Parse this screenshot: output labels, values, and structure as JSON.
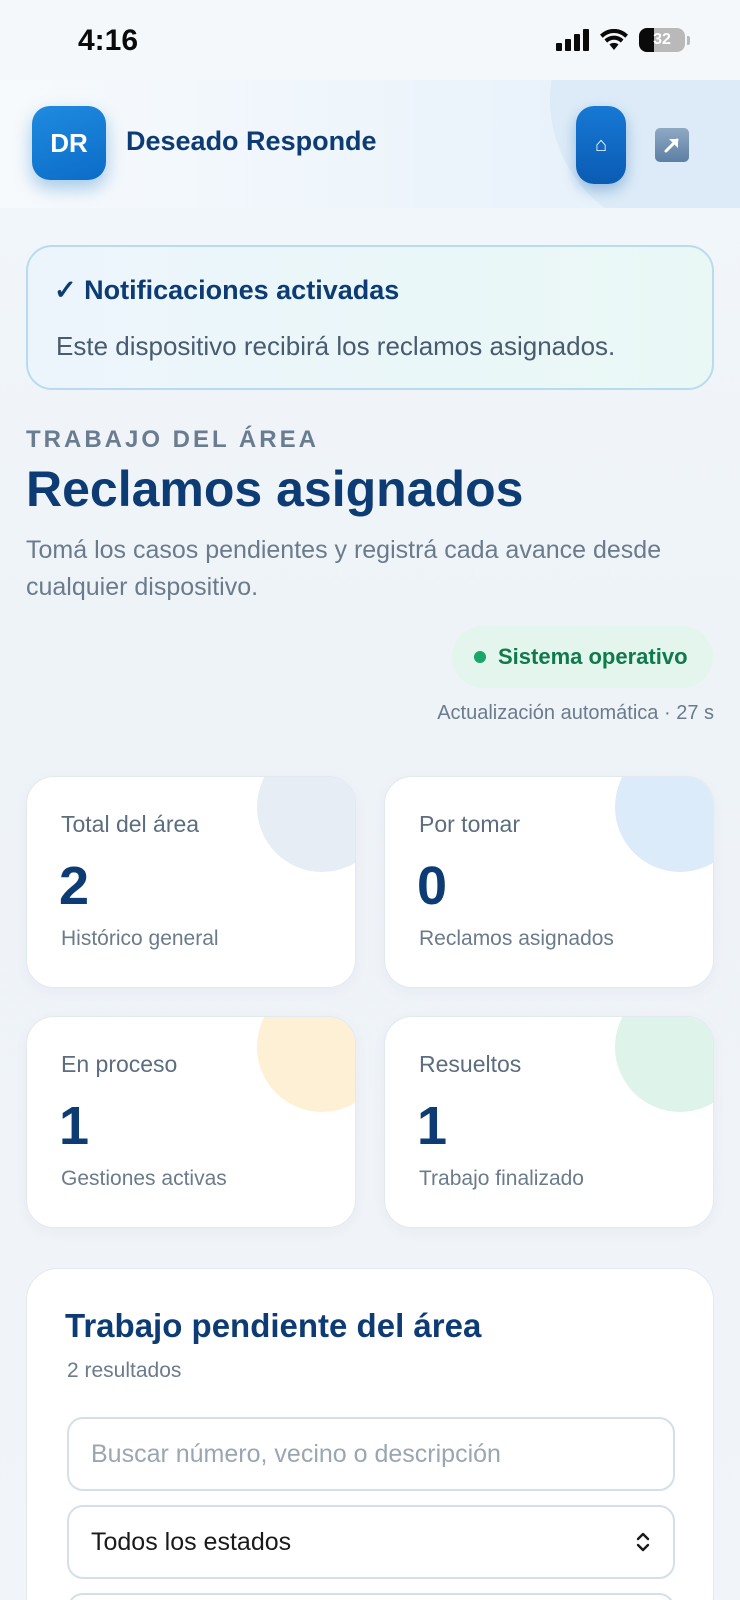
{
  "status_bar": {
    "time": "4:16",
    "battery": "32",
    "battery_level": 0.32,
    "icons": [
      "signal-icon",
      "wifi-icon",
      "battery-icon"
    ]
  },
  "header": {
    "avatar_initials": "DR",
    "app_name": "Deseado Responde",
    "home_icon": "⌂",
    "icons": [
      "home-icon",
      "exit-icon"
    ],
    "accent": "#0b6cc7"
  },
  "notice": {
    "title": "✓ Notificaciones activadas",
    "text": "Este dispositivo recibirá los reclamos asignados."
  },
  "heading": {
    "eyebrow": "TRABAJO DEL ÁREA",
    "title": "Reclamos asignados",
    "subtitle": "Tomá los casos pendientes y registrá cada avance desde cualquier dispositivo."
  },
  "system_status": {
    "label": "Sistema operativo",
    "color": "#1aa66a",
    "auto_update": "Actualización automática · 27 s"
  },
  "stats": [
    {
      "label": "Total del área",
      "value": "2",
      "caption": "Histórico general",
      "color": "#e6edf4"
    },
    {
      "label": "Por tomar",
      "value": "0",
      "caption": "Reclamos asignados",
      "color": "#dcebfa"
    },
    {
      "label": "En proceso",
      "value": "1",
      "caption": "Gestiones activas",
      "color": "#fdf0d4"
    },
    {
      "label": "Resueltos",
      "value": "1",
      "caption": "Trabajo finalizado",
      "color": "#def3ea"
    }
  ],
  "pending": {
    "title": "Trabajo pendiente del área",
    "count": "2 resultados",
    "search_placeholder": "Buscar número, vecino o descripción",
    "status_filter": "Todos los estados"
  }
}
